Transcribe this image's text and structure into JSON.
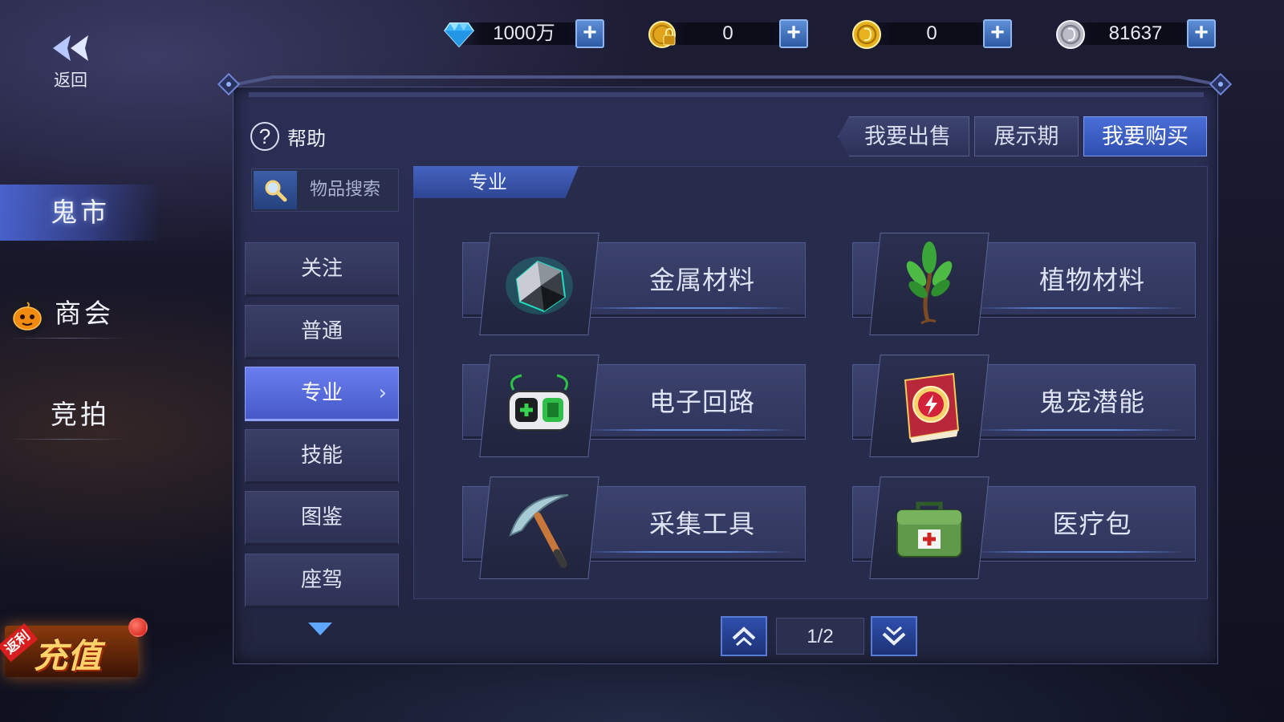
{
  "currencies": [
    {
      "id": "diamond",
      "icon": "diamond-icon",
      "value": "1000万",
      "plus": "+"
    },
    {
      "id": "bound-gold",
      "icon": "locked-coin-icon",
      "value": "0",
      "plus": "+"
    },
    {
      "id": "gold",
      "icon": "gold-coin-icon",
      "value": "0",
      "plus": "+"
    },
    {
      "id": "silver",
      "icon": "silver-coin-icon",
      "value": "81637",
      "plus": "+"
    }
  ],
  "back": {
    "label": "返回"
  },
  "rail": [
    {
      "label": "鬼市",
      "active": true
    },
    {
      "label": "商会",
      "active": false
    },
    {
      "label": "竞拍",
      "active": false
    }
  ],
  "recharge": {
    "label": "充值",
    "ribbon": "返利"
  },
  "help": {
    "icon": "?",
    "label": "帮助"
  },
  "tabs": [
    {
      "label": "我要出售",
      "active": false
    },
    {
      "label": "展示期",
      "active": false
    },
    {
      "label": "我要购买",
      "active": true
    }
  ],
  "search": {
    "placeholder": "物品搜索"
  },
  "categories": [
    {
      "label": "关注",
      "active": false
    },
    {
      "label": "普通",
      "active": false
    },
    {
      "label": "专业",
      "active": true
    },
    {
      "label": "技能",
      "active": false
    },
    {
      "label": "图鉴",
      "active": false
    },
    {
      "label": "座驾",
      "active": false
    }
  ],
  "content": {
    "header": "专业",
    "items": [
      {
        "label": "金属材料",
        "icon": "metal-ore-icon"
      },
      {
        "label": "植物材料",
        "icon": "herb-plant-icon"
      },
      {
        "label": "电子回路",
        "icon": "circuit-device-icon"
      },
      {
        "label": "鬼宠潜能",
        "icon": "potential-book-icon"
      },
      {
        "label": "采集工具",
        "icon": "pickaxe-icon"
      },
      {
        "label": "医疗包",
        "icon": "medkit-icon"
      }
    ]
  },
  "pager": {
    "value": "1/2"
  },
  "colors": {
    "accent": "#4a6ed8",
    "panel": "#2b2f55",
    "active_category": "#5b6ee0"
  }
}
